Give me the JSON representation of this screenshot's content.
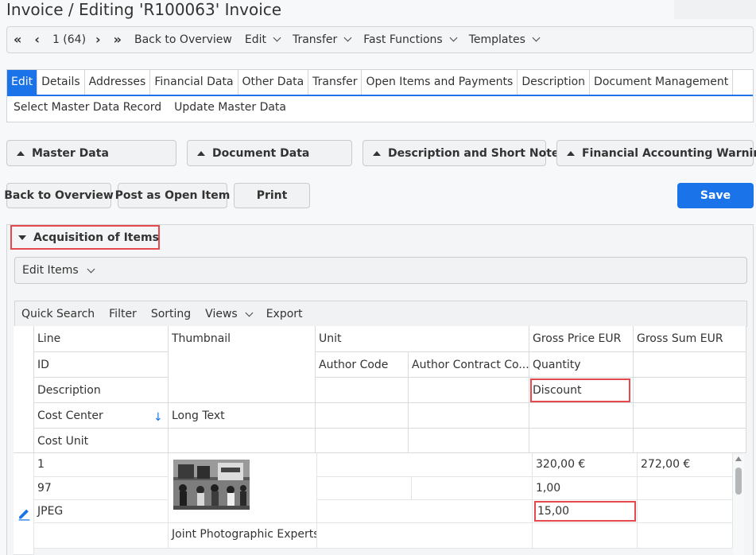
{
  "page": {
    "title": "Invoice / Editing 'R100063' Invoice"
  },
  "toolbar": {
    "first_icon": "double-chevron-left-icon",
    "prev_icon": "chevron-left-icon",
    "counter": "1 (64)",
    "next_icon": "chevron-right-icon",
    "last_icon": "double-chevron-right-icon",
    "back": "Back to Overview",
    "edit": "Edit",
    "transfer": "Transfer",
    "fast_functions": "Fast Functions",
    "templates": "Templates"
  },
  "tabs": [
    {
      "label": "Edit",
      "active": true
    },
    {
      "label": "Details"
    },
    {
      "label": "Addresses"
    },
    {
      "label": "Financial Data"
    },
    {
      "label": "Other Data"
    },
    {
      "label": "Transfer"
    },
    {
      "label": "Open Items and Payments"
    },
    {
      "label": "Description"
    },
    {
      "label": "Document Management"
    }
  ],
  "subtabs": [
    "Select Master Data Record",
    "Update Master Data"
  ],
  "panels": [
    "Master Data",
    "Document Data",
    "Description and Short Notes",
    "Financial Accounting Warnings"
  ],
  "actions": {
    "back": "Back to Overview",
    "post_open_item": "Post as Open Item",
    "print": "Print",
    "save": "Save"
  },
  "acquisition": {
    "title": "Acquisition of Items",
    "edit_items": "Edit Items"
  },
  "grid_toolbar": [
    "Quick Search",
    "Filter",
    "Sorting",
    "Views",
    "Export"
  ],
  "columns": {
    "line": "Line",
    "id": "ID",
    "description": "Description",
    "cost_center": "Cost Center",
    "cost_unit": "Cost Unit",
    "thumbnail": "Thumbnail",
    "long_text": "Long Text",
    "unit": "Unit",
    "author_code": "Author Code",
    "author_contract": "Author Contract Co...",
    "gross_price": "Gross Price EUR",
    "quantity": "Quantity",
    "discount": "Discount",
    "gross_sum": "Gross Sum EUR"
  },
  "row": {
    "line": "1",
    "id": "97",
    "description": "JPEG",
    "long_text": "Joint Photographic Experts Group",
    "gross_price": "320,00 €",
    "quantity": "1,00",
    "discount": "15,00",
    "gross_sum": "272,00 €"
  },
  "colors": {
    "accent": "#1a73e8",
    "highlight": "#e5484d"
  }
}
